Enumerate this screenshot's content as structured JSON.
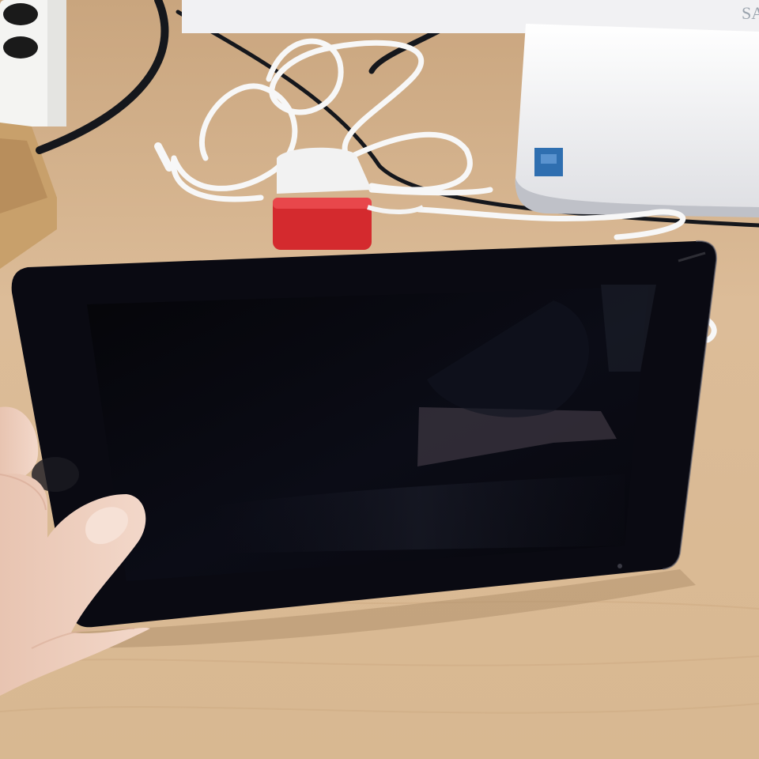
{
  "scene": {
    "description_free": true,
    "objects": {
      "desk": {
        "color": "#dcbc98"
      },
      "tablet": {
        "screen_state": "off",
        "screen_color": "#06060d",
        "bezel_color": "#0a0a12"
      },
      "hand": {
        "skin_color": "#f0d2c2"
      },
      "charger": {
        "color": "#d42a2e"
      },
      "usb_cable": {
        "color": "#f4f4f4"
      },
      "monitor_stand": {
        "color": "#f2f2f4",
        "sticker_color": "#2f6fb0"
      },
      "power_strip": {
        "color": "#f4f4f2"
      },
      "black_cable": {
        "color": "#15171c"
      }
    },
    "visible_text": {
      "monitor_brand_fragment": "SA"
    }
  }
}
